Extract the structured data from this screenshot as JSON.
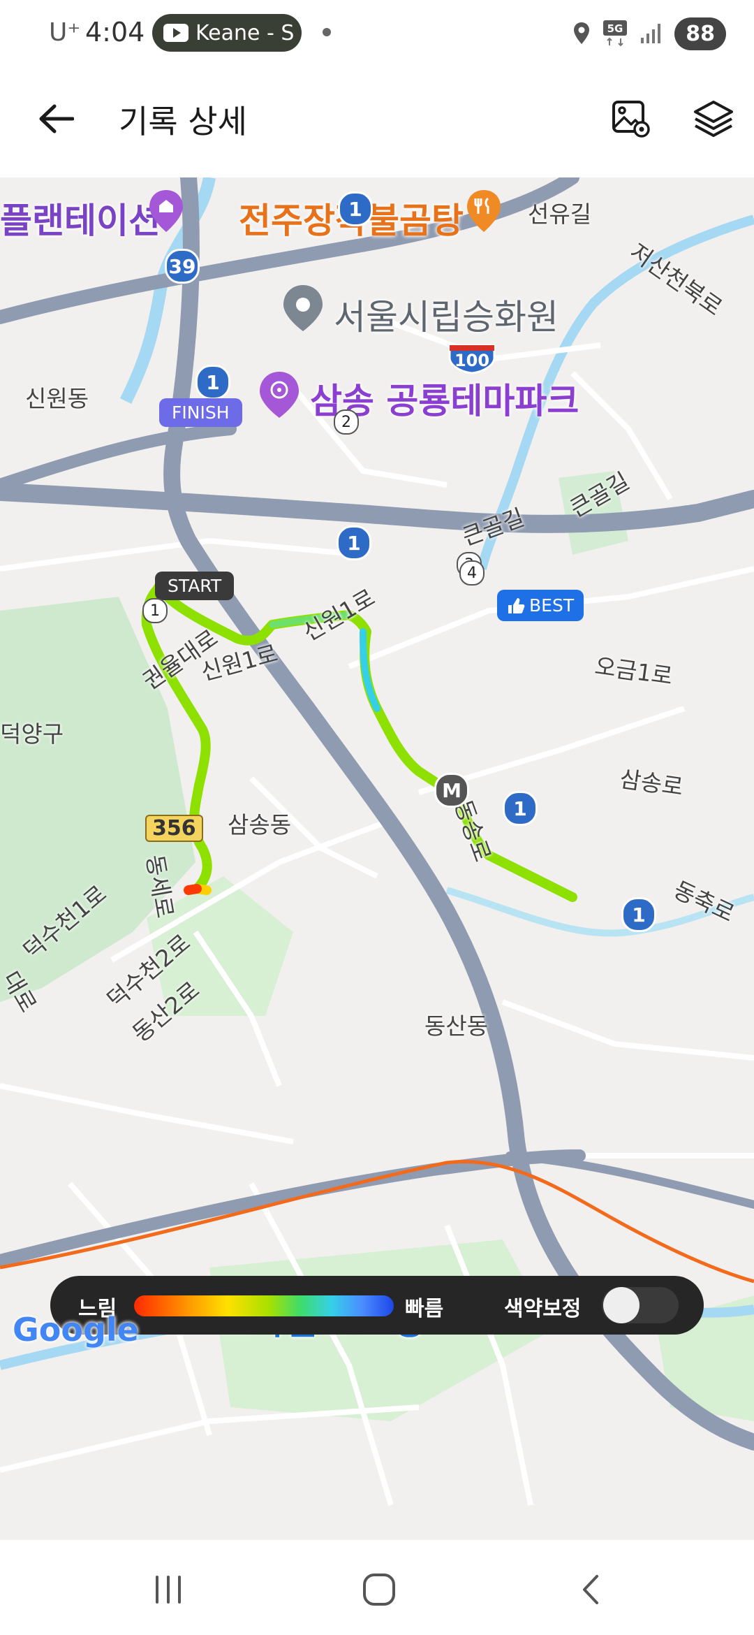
{
  "status_bar": {
    "carrier": "U⁺",
    "time": "4:04",
    "media_pill_text": "Keane - S",
    "battery": "88"
  },
  "header": {
    "title": "기록 상세"
  },
  "map": {
    "poi": {
      "plantation": "플랜테이션",
      "restaurant": "전주장작불곰탕",
      "crematorium": "서울시립승화원",
      "theme_park": "삼송 공룡테마파크",
      "starfield": "스타필드 고양"
    },
    "streets": {
      "seonyu": "선유길",
      "jeosan": "저산천북로",
      "sinwondong": "신원동",
      "keungol1": "큰골길",
      "keungol2": "큰골길",
      "gwonyul": "권율대로",
      "sinwon1a": "신원1로",
      "sinwon1b": "신원1로",
      "ogeum": "오금1로",
      "deogyang": "덕양구",
      "samsongro": "삼송로",
      "samsongdong": "삼송동",
      "dongsongro": "동송로",
      "dongsero": "동세로",
      "dongchukro": "동축로",
      "deoksucheon1": "덕수천1로",
      "deoksucheon2": "덕수천2로",
      "dongsan2": "동산2로",
      "dongsandong": "동산동",
      "daero": "대로"
    },
    "route_shields": {
      "r1": "1",
      "r39": "39",
      "r100": "100",
      "r356": "356",
      "metro": "M"
    },
    "run_markers": {
      "start": "START",
      "finish": "FINISH",
      "best": "BEST"
    },
    "laps": {
      "lap1": "1",
      "lap2": "2",
      "lap3": "3",
      "lap4": "4"
    },
    "google": "Google"
  },
  "legend": {
    "slow": "느림",
    "fast": "빠름",
    "colorblind": "색약보정",
    "colorblind_on": false
  },
  "colors": {
    "route_green": "#8de000",
    "route_cyan": "#35d0e8",
    "best_blue": "#1f6fe6",
    "finish_purple": "#6e6be8",
    "start_gray": "#3a3a3a"
  }
}
